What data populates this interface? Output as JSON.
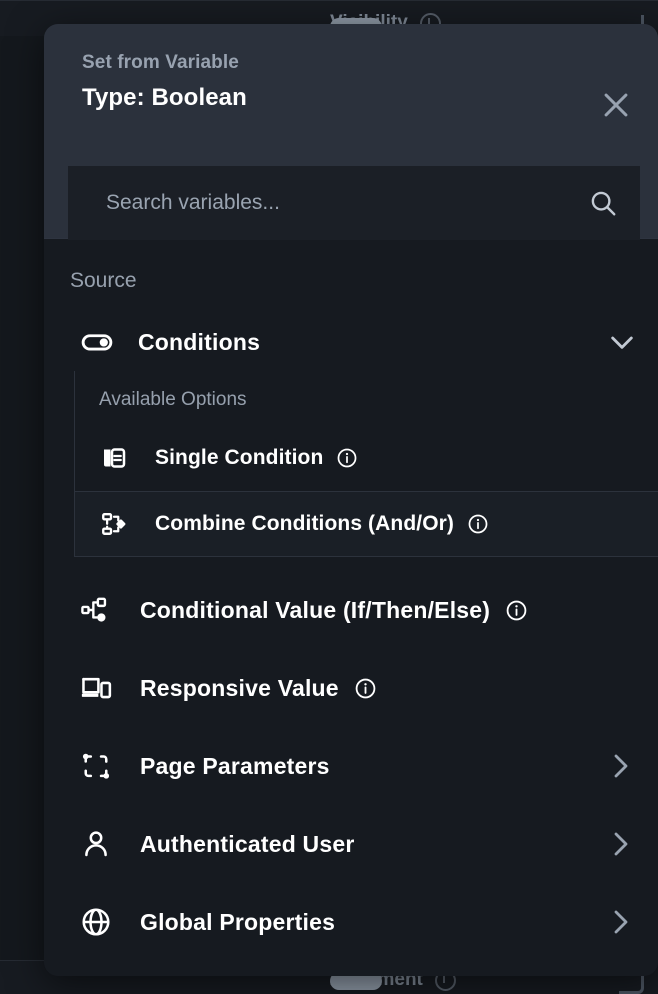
{
  "background": {
    "top_control": {
      "label": "Visibility",
      "icon": "toggle-switch",
      "info_icon": "info-icon"
    },
    "bottom_control": {
      "label": "Alignment",
      "icon": "toggle-switch",
      "info_icon": "info-icon"
    }
  },
  "modal": {
    "eyebrow": "Set from Variable",
    "title": "Type: Boolean",
    "close_icon": "close-icon",
    "search": {
      "placeholder": "Search variables...",
      "value": "",
      "icon": "search-icon"
    },
    "section_label": "Source",
    "group": {
      "label": "Conditions",
      "icon": "toggle-switch-icon",
      "chevron": "chevron-down-icon",
      "expanded": true,
      "sub_label": "Available Options",
      "options": [
        {
          "label": "Single Condition",
          "icon": "single-condition-icon",
          "info": "info-icon",
          "selected": false
        },
        {
          "label": "Combine Conditions (And/Or)",
          "icon": "combine-conditions-icon",
          "info": "info-icon",
          "selected": true
        }
      ]
    },
    "rows": [
      {
        "label": "Conditional Value (If/Then/Else)",
        "icon": "conditional-value-icon",
        "info": "info-icon",
        "chevron": ""
      },
      {
        "label": "Responsive Value",
        "icon": "responsive-value-icon",
        "info": "info-icon",
        "chevron": ""
      },
      {
        "label": "Page Parameters",
        "icon": "page-parameters-icon",
        "info": "",
        "chevron": "chevron-right-icon"
      },
      {
        "label": "Authenticated User",
        "icon": "user-icon",
        "info": "",
        "chevron": "chevron-right-icon"
      },
      {
        "label": "Global Properties",
        "icon": "globe-icon",
        "info": "",
        "chevron": "chevron-right-icon"
      }
    ]
  },
  "colors": {
    "page_background": "#14181d",
    "panel_body": "#161a20",
    "panel_header": "#2b313c",
    "search_field": "#1b1f26",
    "text_primary": "#ffffff",
    "text_muted": "#97a1ae",
    "divider": "#2c323c"
  }
}
